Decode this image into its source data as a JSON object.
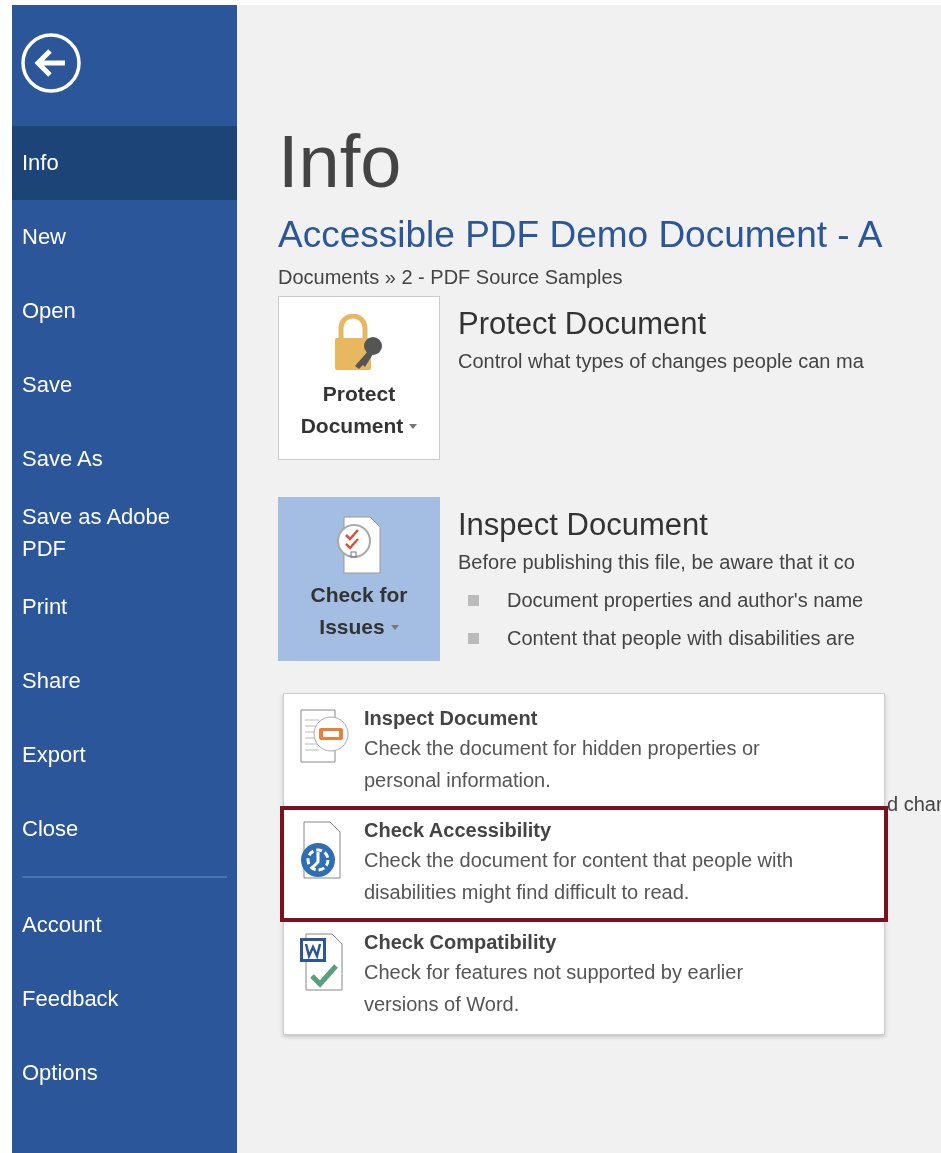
{
  "sidebar": {
    "items": [
      {
        "label": "Info",
        "selected": true
      },
      {
        "label": "New",
        "selected": false
      },
      {
        "label": "Open",
        "selected": false
      },
      {
        "label": "Save",
        "selected": false
      },
      {
        "label": "Save As",
        "selected": false
      },
      {
        "label": "Save as Adobe PDF",
        "selected": false
      },
      {
        "label": "Print",
        "selected": false
      },
      {
        "label": "Share",
        "selected": false
      },
      {
        "label": "Export",
        "selected": false
      },
      {
        "label": "Close",
        "selected": false
      }
    ],
    "bottom_items": [
      {
        "label": "Account",
        "selected": false
      },
      {
        "label": "Feedback",
        "selected": false
      },
      {
        "label": "Options",
        "selected": false
      }
    ]
  },
  "main": {
    "heading": "Info",
    "document_title": "Accessible PDF Demo Document - A",
    "breadcrumb": "Documents » 2 - PDF Source Samples",
    "sections": [
      {
        "kind": "protect",
        "button_lines": [
          "Protect",
          "Document"
        ],
        "pressed": false,
        "title": "Protect Document",
        "description": "Control what types of changes people can ma"
      },
      {
        "kind": "inspect",
        "button_lines": [
          "Check for",
          "Issues"
        ],
        "pressed": true,
        "title": "Inspect Document",
        "description": "Before publishing this file, be aware that it co",
        "bullets": [
          "Document properties and author's name",
          "Content that people with disabilities are"
        ]
      }
    ],
    "hidden_fragment": "d char"
  },
  "dropdown": {
    "items": [
      {
        "kind": "inspect",
        "title": "Inspect Document",
        "description": "Check the document for hidden properties or personal information.",
        "selected": false
      },
      {
        "kind": "accessibility",
        "title": "Check Accessibility",
        "description": "Check the document for content that people with disabilities might find difficult to read.",
        "selected": true
      },
      {
        "kind": "compatibility",
        "title": "Check Compatibility",
        "description": "Check for features not supported by earlier versions of Word.",
        "selected": false
      }
    ]
  }
}
